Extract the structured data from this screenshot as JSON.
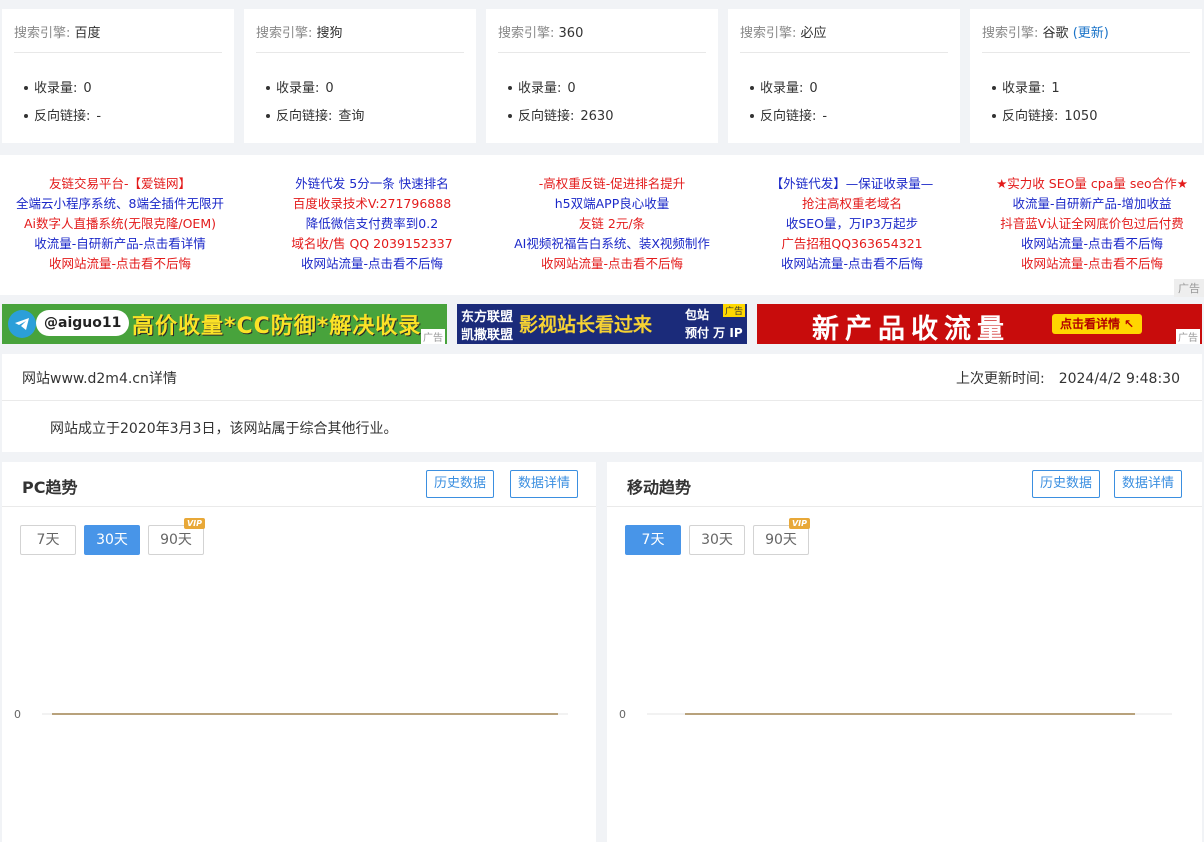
{
  "engines": [
    {
      "label": "搜索引擎:",
      "name": "百度",
      "link": "",
      "index_label": "收录量:",
      "index_value": "0",
      "backlink_label": "反向链接:",
      "backlink_value": "-"
    },
    {
      "label": "搜索引擎:",
      "name": "搜狗",
      "link": "",
      "index_label": "收录量:",
      "index_value": "0",
      "backlink_label": "反向链接:",
      "backlink_value": "查询"
    },
    {
      "label": "搜索引擎:",
      "name": "360",
      "link": "",
      "index_label": "收录量:",
      "index_value": "0",
      "backlink_label": "反向链接:",
      "backlink_value": "2630"
    },
    {
      "label": "搜索引擎:",
      "name": "必应",
      "link": "",
      "index_label": "收录量:",
      "index_value": "0",
      "backlink_label": "反向链接:",
      "backlink_value": "-"
    },
    {
      "label": "搜索引擎:",
      "name": "谷歌",
      "link": "(更新)",
      "index_label": "收录量:",
      "index_value": "1",
      "backlink_label": "反向链接:",
      "backlink_value": "1050"
    }
  ],
  "text_ads": {
    "columns": [
      [
        "友链交易平台-【爱链网】",
        "全端云小程序系统、8端全插件无限开",
        "Ai数字人直播系统(无限克隆/OEM)",
        "收流量-自研新产品-点击看详情",
        "收网站流量-点击看不后悔"
      ],
      [
        "外链代发 5分一条 快速排名",
        "百度收录技术V:271796888",
        "降低微信支付费率到0.2",
        "域名收/售 QQ 2039152337",
        "收网站流量-点击看不后悔"
      ],
      [
        "-高权重反链-促进排名提升",
        "h5双端APP良心收量",
        "友链 2元/条",
        "AI视频祝福告白系统、装X视频制作",
        "收网站流量-点击看不后悔"
      ],
      [
        "【外链代发】—保证收录量—",
        "抢注高权重老域名",
        "收SEO量，万IP3万起步",
        "广告招租QQ363654321",
        "收网站流量-点击看不后悔"
      ],
      [
        "★实力收 SEO量 cpa量 seo合作★",
        "收流量-自研新产品-增加收益",
        "抖音蓝V认证全网底价包过后付费",
        "收网站流量-点击看不后悔",
        "收网站流量-点击看不后悔"
      ]
    ],
    "colors": [
      [
        "red",
        "blue",
        "red",
        "blue",
        "red"
      ],
      [
        "blue",
        "red",
        "blue",
        "red",
        "blue"
      ],
      [
        "red",
        "blue",
        "red",
        "blue",
        "red"
      ],
      [
        "blue",
        "red",
        "blue",
        "red",
        "blue"
      ],
      [
        "red",
        "blue",
        "red",
        "blue",
        "red"
      ]
    ],
    "ad_tag": "广告"
  },
  "banners": {
    "b1": {
      "handle": "@aiguo11",
      "slogan": "高价收量*CC防御*解决收录",
      "tag": "广告"
    },
    "b2": {
      "line1": "东方联盟",
      "line2": "凯撒联盟",
      "main": "影视站长看过来",
      "side1": "包站",
      "side2": "预付 万 IP",
      "tag": "广告"
    },
    "b3": {
      "main": "新产品收流量",
      "cta": "点击看详情 ↖",
      "tag": "广告"
    }
  },
  "site": {
    "title": "网站www.d2m4.cn详情",
    "updated_label": "上次更新时间:",
    "updated_value": "2024/4/2 9:48:30",
    "description": "网站成立于2020年3月3日，该网站属于综合其他行业。"
  },
  "pc_trend": {
    "title": "PC趋势",
    "history_button": "历史数据",
    "detail_button": "数据详情",
    "ranges": [
      "7天",
      "30天",
      "90天"
    ],
    "active_range": "30天",
    "vip_badge": "VIP",
    "chart_data": {
      "type": "line",
      "y_tick": "0",
      "values": [
        0,
        0,
        0,
        0,
        0,
        0,
        0,
        0,
        0,
        0
      ],
      "line_color": "#b8a27c"
    }
  },
  "mobile_trend": {
    "title": "移动趋势",
    "history_button": "历史数据",
    "detail_button": "数据详情",
    "ranges": [
      "7天",
      "30天",
      "90天"
    ],
    "active_range": "7天",
    "vip_badge": "VIP",
    "chart_data": {
      "type": "line",
      "y_tick": "0",
      "values": [
        0,
        0,
        0,
        0,
        0,
        0,
        0
      ],
      "line_color": "#b8a27c"
    }
  }
}
